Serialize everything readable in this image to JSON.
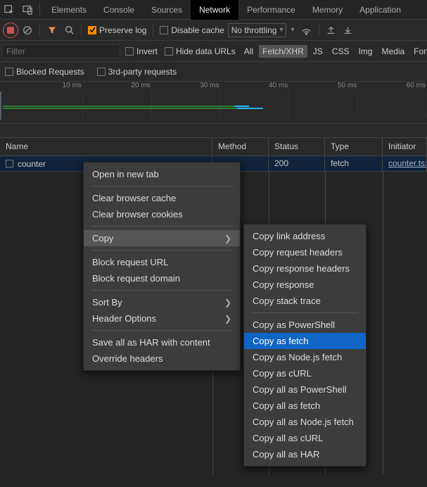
{
  "tabs": {
    "items": [
      "Elements",
      "Console",
      "Sources",
      "Network",
      "Performance",
      "Memory",
      "Application"
    ],
    "active": "Network"
  },
  "toolbar": {
    "preserve_log_label": "Preserve log",
    "disable_cache_label": "Disable cache",
    "throttling": "No throttling"
  },
  "filter": {
    "placeholder": "Filter",
    "invert_label": "Invert",
    "hide_data_urls_label": "Hide data URLs",
    "types": [
      "All",
      "Fetch/XHR",
      "JS",
      "CSS",
      "Img",
      "Media",
      "Font"
    ],
    "type_active": "Fetch/XHR",
    "blocked_requests_label": "Blocked Requests",
    "third_party_label": "3rd-party requests"
  },
  "timeline": {
    "ticks": [
      "10 ms",
      "20 ms",
      "30 ms",
      "40 ms",
      "50 ms",
      "60 ms"
    ]
  },
  "table": {
    "headers": {
      "name": "Name",
      "method": "Method",
      "status": "Status",
      "type": "Type",
      "initiator": "Initiator"
    },
    "rows": [
      {
        "name": "counter",
        "method": "",
        "status": "200",
        "type": "fetch",
        "initiator": "counter.ts:"
      }
    ]
  },
  "context_menu": {
    "open_new_tab": "Open in new tab",
    "clear_cache": "Clear browser cache",
    "clear_cookies": "Clear browser cookies",
    "copy": "Copy",
    "block_url": "Block request URL",
    "block_domain": "Block request domain",
    "sort_by": "Sort By",
    "header_options": "Header Options",
    "save_har": "Save all as HAR with content",
    "override_headers": "Override headers",
    "sub": {
      "link_addr": "Copy link address",
      "req_headers": "Copy request headers",
      "resp_headers": "Copy response headers",
      "response": "Copy response",
      "stack_trace": "Copy stack trace",
      "as_powershell": "Copy as PowerShell",
      "as_fetch": "Copy as fetch",
      "as_node_fetch": "Copy as Node.js fetch",
      "as_curl": "Copy as cURL",
      "all_powershell": "Copy all as PowerShell",
      "all_fetch": "Copy all as fetch",
      "all_node_fetch": "Copy all as Node.js fetch",
      "all_curl": "Copy all as cURL",
      "all_har": "Copy all as HAR"
    }
  }
}
